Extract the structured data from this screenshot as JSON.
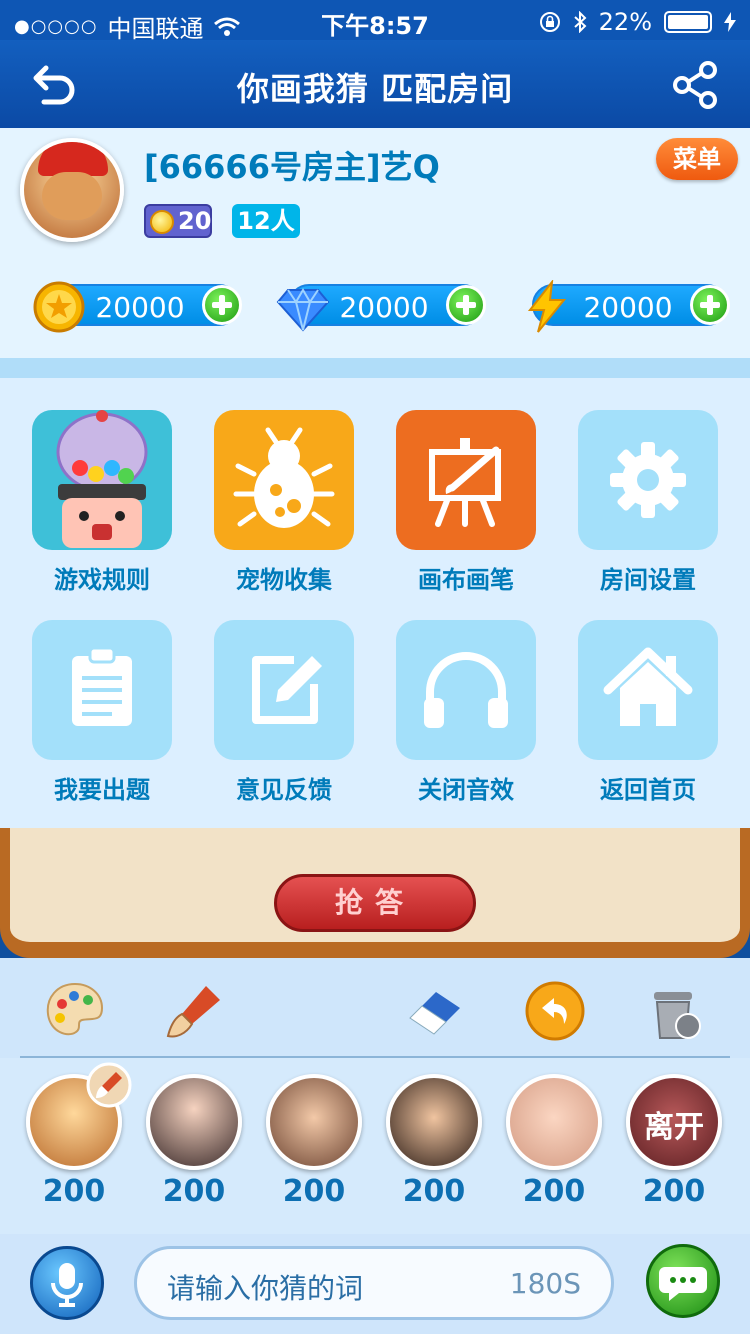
{
  "status_bar": {
    "signal_dots": "●○○○○",
    "carrier": "中国联通",
    "time": "下午8:57",
    "battery": "22%"
  },
  "header": {
    "title": "你画我猜  匹配房间",
    "back_icon": "back-arrow-icon",
    "share_icon": "share-icon"
  },
  "room": {
    "host_name": "[66666号房主]艺Q",
    "coin_count": "20",
    "people_count": "12人",
    "menu_label": "菜单"
  },
  "resources": [
    {
      "icon": "gold-coin-icon",
      "value": "20000"
    },
    {
      "icon": "diamond-icon",
      "value": "20000"
    },
    {
      "icon": "lightning-icon",
      "value": "20000"
    }
  ],
  "grid": [
    {
      "label": "游戏规则",
      "icon": "candy-jar-character-icon",
      "color": "#ffffff"
    },
    {
      "label": "宠物收集",
      "icon": "bug-icon",
      "color": "#f8a819"
    },
    {
      "label": "画布画笔",
      "icon": "easel-brush-icon",
      "color": "#ed6d20"
    },
    {
      "label": "房间设置",
      "icon": "gear-icon",
      "color": "#a3e0fa"
    },
    {
      "label": "我要出题",
      "icon": "clipboard-icon",
      "color": "#a3e0fa"
    },
    {
      "label": "意见反馈",
      "icon": "edit-icon",
      "color": "#a3e0fa"
    },
    {
      "label": "关闭音效",
      "icon": "headphones-icon",
      "color": "#a3e0fa"
    },
    {
      "label": "返回首页",
      "icon": "home-icon",
      "color": "#a3e0fa"
    }
  ],
  "game": {
    "answer_button": "抢答"
  },
  "tools": [
    "palette-icon",
    "brush-icon",
    "eraser-icon",
    "undo-icon",
    "trash-icon"
  ],
  "players": [
    {
      "score": "200",
      "avatar": "player-avatar-1"
    },
    {
      "score": "200",
      "avatar": "player-avatar-2"
    },
    {
      "score": "200",
      "avatar": "player-avatar-3"
    },
    {
      "score": "200",
      "avatar": "player-avatar-4"
    },
    {
      "score": "200",
      "avatar": "player-avatar-5"
    },
    {
      "score": "200",
      "avatar": "player-avatar-6",
      "status": "离开"
    }
  ],
  "input": {
    "placeholder": "请输入你猜的词",
    "timer": "180S"
  },
  "colors": {
    "title_bar": "#0b4aa5",
    "accent_blue": "#007bba",
    "coin_chip": "#6163cf",
    "people_chip": "#00b5e9",
    "resource_pill": "#00a8ff",
    "resource_border": "#1781e2",
    "divider": "#0095e2"
  }
}
